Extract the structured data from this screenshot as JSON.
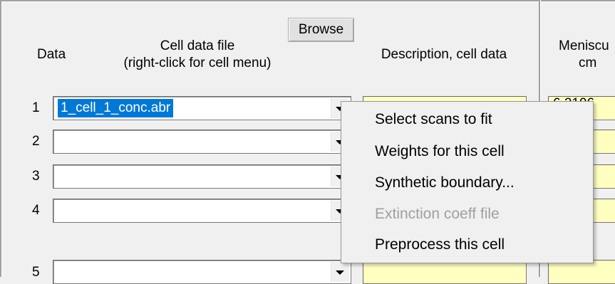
{
  "headers": {
    "data": "Data",
    "cell_file_line1": "Cell data file",
    "cell_file_line2": "(right-click for cell menu)",
    "description": "Description, cell data",
    "meniscus_line1": "Meniscu",
    "meniscus_line2": "cm"
  },
  "browse_label": "Browse",
  "rows": [
    {
      "num": "1",
      "file": "1_cell_1_conc.abr",
      "meniscus": "6.2196"
    },
    {
      "num": "2",
      "file": "",
      "meniscus": ""
    },
    {
      "num": "3",
      "file": "",
      "meniscus": ""
    },
    {
      "num": "4",
      "file": "",
      "meniscus": ""
    },
    {
      "num": "5",
      "file": "",
      "meniscus": ""
    }
  ],
  "context_menu": [
    {
      "label": "Select scans to fit",
      "enabled": true
    },
    {
      "label": "Weights for this cell",
      "enabled": true
    },
    {
      "label": "Synthetic boundary...",
      "enabled": true
    },
    {
      "label": "Extinction coeff file",
      "enabled": false
    },
    {
      "label": "Preprocess this cell",
      "enabled": true
    }
  ],
  "colors": {
    "field_bg": "#ffffc0",
    "selection": "#0078d7",
    "disabled_text": "#a0a0a0"
  }
}
